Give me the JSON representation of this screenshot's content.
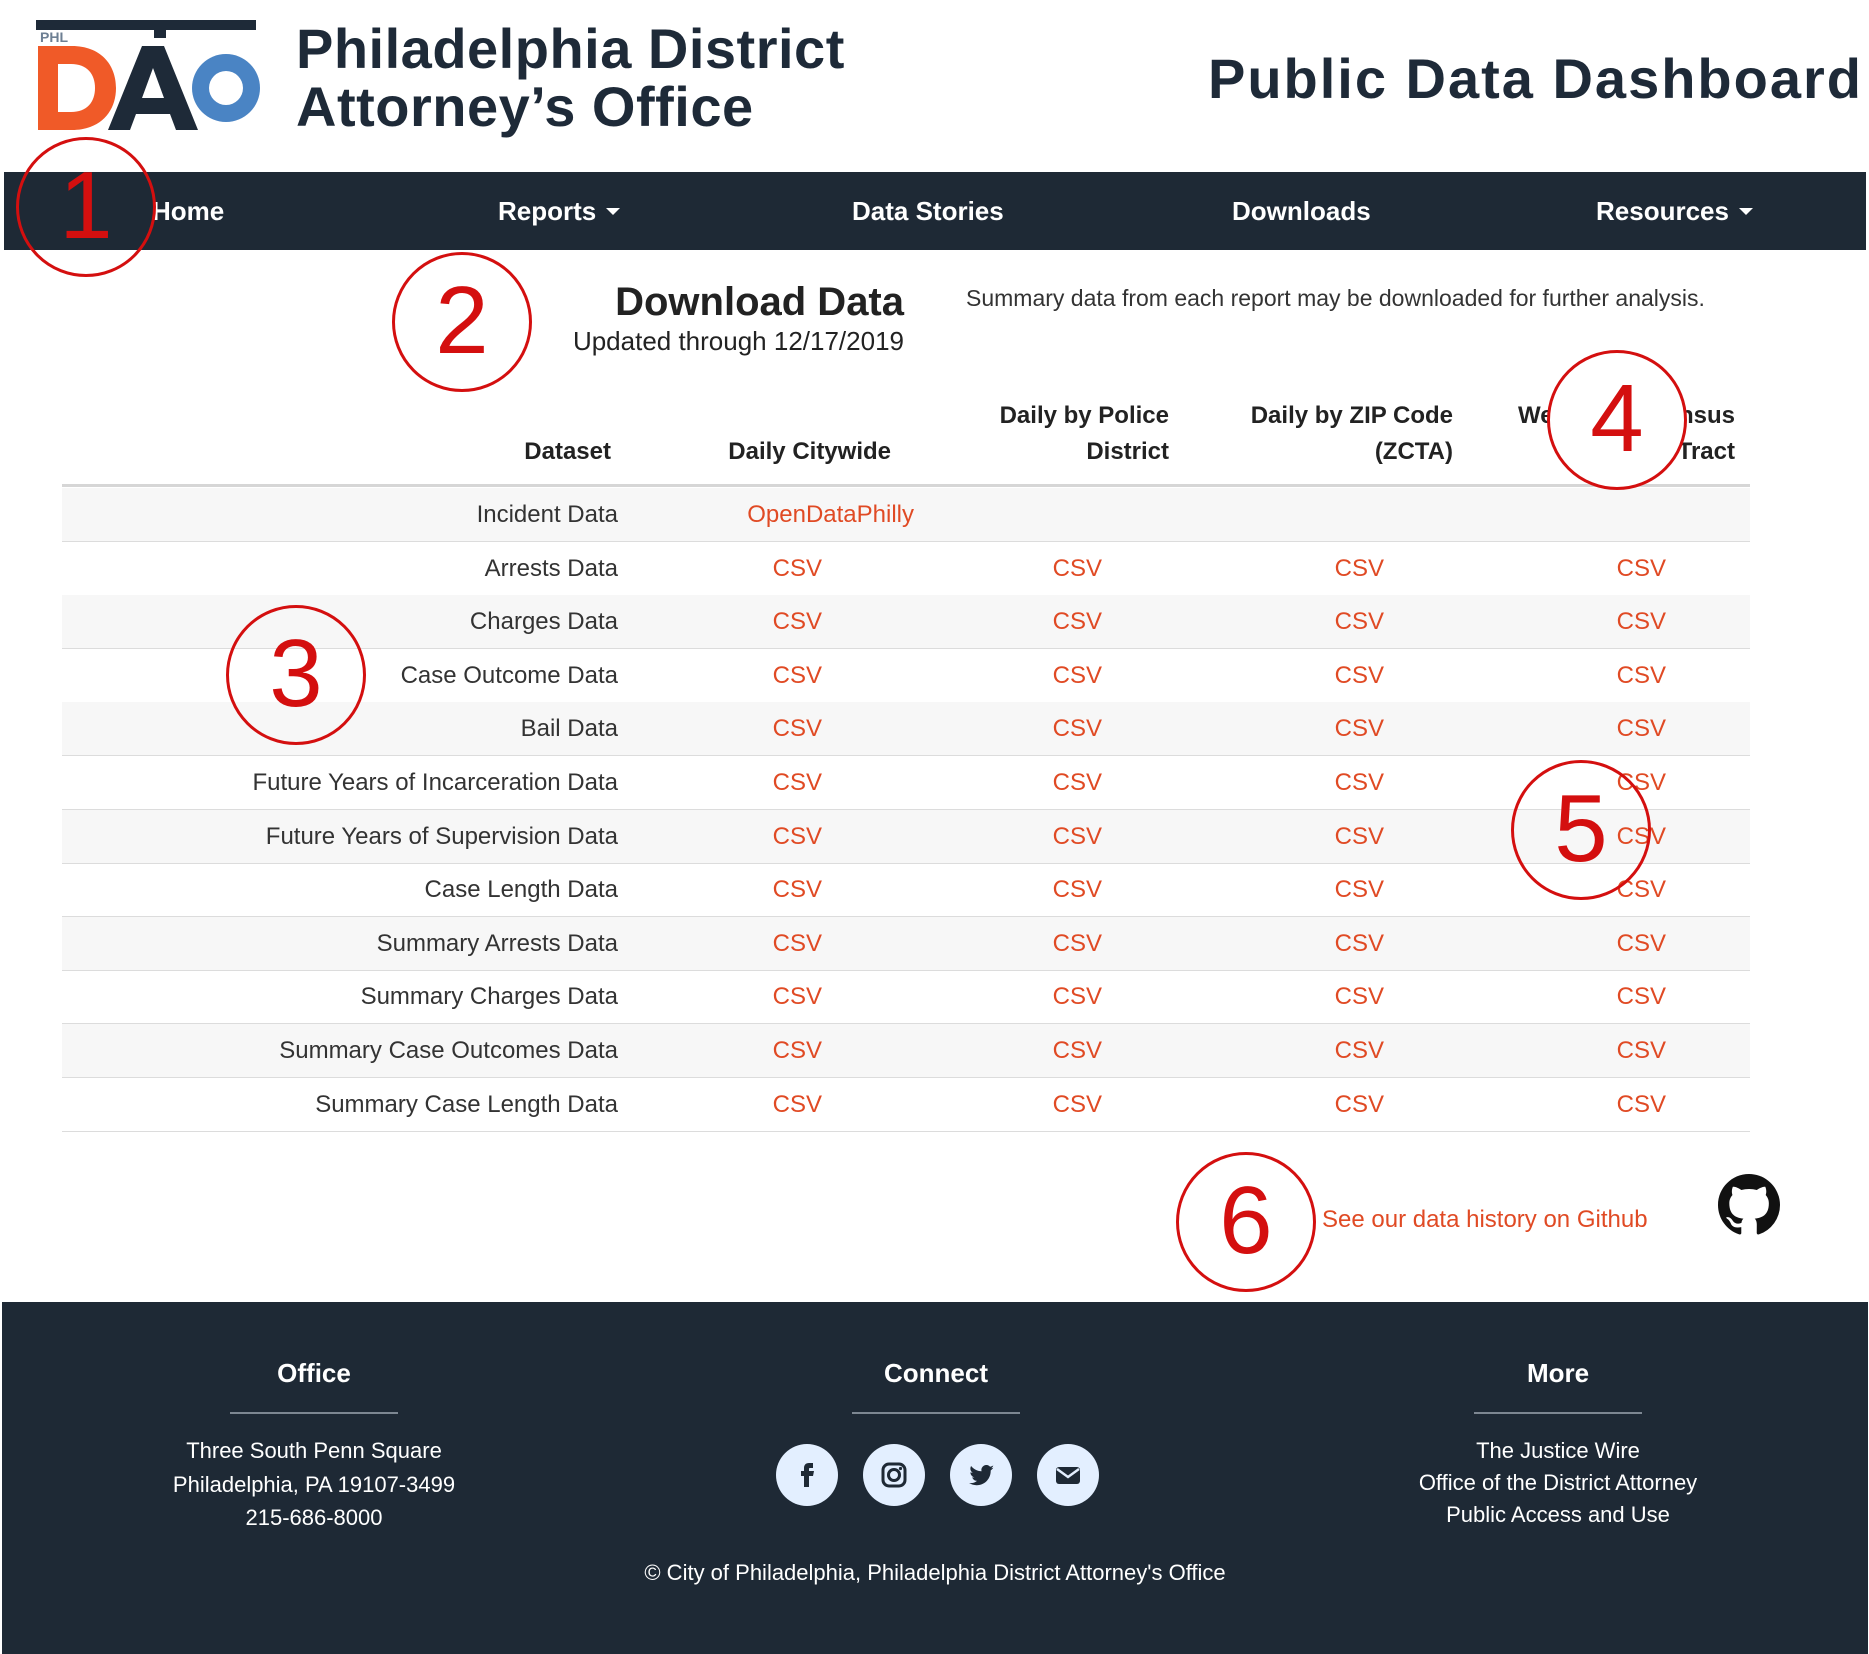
{
  "header": {
    "logo_small_text": "PHL",
    "logo_text": "DAO",
    "org_name_line1": "Philadelphia District",
    "org_name_line2": "Attorney’s Office",
    "dashboard_title": "Public Data Dashboard"
  },
  "nav": {
    "items": [
      {
        "label": "Home"
      },
      {
        "label": "Reports"
      },
      {
        "label": "Data Stories"
      },
      {
        "label": "Downloads"
      },
      {
        "label": "Resources"
      }
    ]
  },
  "intro": {
    "title": "Download Data",
    "updated": "Updated through 12/17/2019",
    "description": "Summary data from each report may be downloaded for further analysis."
  },
  "table": {
    "columns": [
      "Dataset",
      "Daily Citywide",
      "Daily by Police District",
      "Daily by ZIP Code (ZCTA)",
      "Weekly by Census Tract"
    ],
    "column_lines": [
      [
        "Dataset"
      ],
      [
        "Daily Citywide"
      ],
      [
        "Daily by Police",
        "District"
      ],
      [
        "Daily by ZIP Code",
        "(ZCTA)"
      ],
      [
        "We",
        "nsus",
        "Tract"
      ]
    ],
    "rows": [
      {
        "dataset": "Incident Data",
        "cells": [
          "OpenDataPhilly",
          "",
          "",
          ""
        ]
      },
      {
        "dataset": "Arrests Data",
        "cells": [
          "CSV",
          "CSV",
          "CSV",
          "CSV"
        ]
      },
      {
        "dataset": "Charges Data",
        "cells": [
          "CSV",
          "CSV",
          "CSV",
          "CSV"
        ]
      },
      {
        "dataset": "Case Outcome Data",
        "cells": [
          "CSV",
          "CSV",
          "CSV",
          "CSV"
        ]
      },
      {
        "dataset": "Bail Data",
        "cells": [
          "CSV",
          "CSV",
          "CSV",
          "CSV"
        ]
      },
      {
        "dataset": "Future Years of Incarceration Data",
        "cells": [
          "CSV",
          "CSV",
          "CSV",
          "CSV"
        ]
      },
      {
        "dataset": "Future Years of Supervision Data",
        "cells": [
          "CSV",
          "CSV",
          "CSV",
          "CSV"
        ]
      },
      {
        "dataset": "Case Length Data",
        "cells": [
          "CSV",
          "CSV",
          "CSV",
          "CSV"
        ]
      },
      {
        "dataset": "Summary Arrests Data",
        "cells": [
          "CSV",
          "CSV",
          "CSV",
          "CSV"
        ]
      },
      {
        "dataset": "Summary Charges Data",
        "cells": [
          "CSV",
          "CSV",
          "CSV",
          "CSV"
        ]
      },
      {
        "dataset": "Summary Case Outcomes Data",
        "cells": [
          "CSV",
          "CSV",
          "CSV",
          "CSV"
        ]
      },
      {
        "dataset": "Summary Case Length Data",
        "cells": [
          "CSV",
          "CSV",
          "CSV",
          "CSV"
        ]
      }
    ]
  },
  "github": {
    "link_label": "See our data history on Github",
    "icon": "github-icon"
  },
  "annotations": [
    "1",
    "2",
    "3",
    "4",
    "5",
    "6"
  ],
  "footer": {
    "office": {
      "heading": "Office",
      "lines": [
        "Three South Penn Square",
        "Philadelphia, PA 19107-3499",
        "215-686-8000"
      ]
    },
    "connect": {
      "heading": "Connect",
      "icons": [
        "facebook-icon",
        "instagram-icon",
        "twitter-icon",
        "email-icon"
      ]
    },
    "more": {
      "heading": "More",
      "links": [
        "The Justice Wire",
        "Office of the District Attorney",
        "Public Access and Use"
      ]
    },
    "copyright": "© City of Philadelphia, Philadelphia District Attorney's Office"
  },
  "colors": {
    "navy": "#1e2935",
    "link_orange": "#e04a24",
    "logo_orange": "#f05a28",
    "logo_blue": "#4a84c4",
    "annotation_red": "#d40f0f",
    "social_bg": "#e3efff"
  }
}
